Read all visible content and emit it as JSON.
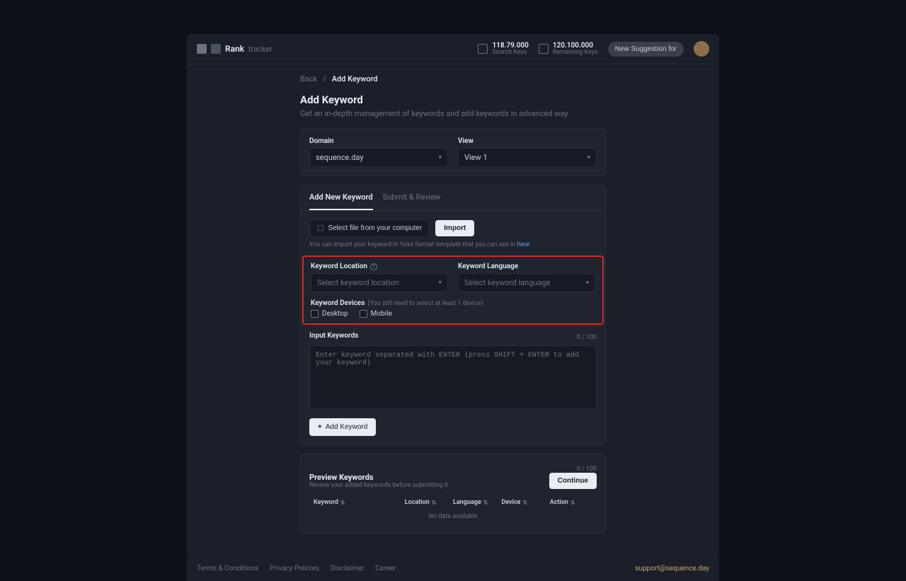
{
  "header": {
    "brand": "Rank",
    "brand_sub": "tracker",
    "stat1_num": "118.79.000",
    "stat1_label": "Search Keys",
    "stat2_num": "120.100.000",
    "stat2_label": "Remaining Keys",
    "cta": "New Suggestion for",
    "avatar": "user"
  },
  "breadcrumb": {
    "back": "Back",
    "current": "Add Keyword"
  },
  "page": {
    "title": "Add Keyword",
    "subtitle": "Get an in-depth management of keywords and add keywords in advanced way"
  },
  "domain_view": {
    "domain_label": "Domain",
    "domain_value": "sequence.day",
    "view_label": "View",
    "view_value": "View 1"
  },
  "tabs": {
    "add": "Add New Keyword",
    "submit": "Submit & Review"
  },
  "file": {
    "select": "Select file from your computer",
    "import": "Import",
    "hint_pre": "You can import your keyword in *xlsx format template that you can see in ",
    "hint_link": "here"
  },
  "location": {
    "label": "Keyword Location",
    "placeholder": "Select keyword location"
  },
  "language": {
    "label": "Keyword Language",
    "placeholder": "Select keyword language"
  },
  "devices": {
    "label": "Keyword Devices",
    "hint": "(You still need to select at least 1 device)",
    "desktop": "Desktop",
    "mobile": "Mobile"
  },
  "input_kw": {
    "label": "Input Keywords",
    "count": "0 / 100",
    "placeholder": "Enter keyword separated with ENTER (press SHIFT + ENTER to add your keyword)"
  },
  "add_btn": "Add Keyword",
  "preview": {
    "count": "0 / 100",
    "title": "Preview Keywords",
    "sub": "Review your added keywords before submitting it",
    "continue": "Continue",
    "cols": {
      "kw": "Keyword",
      "loc": "Location",
      "lang": "Language",
      "dev": "Device",
      "act": "Action"
    },
    "no_data": "No data available"
  },
  "footer": {
    "terms": "Terms & Conditions",
    "privacy": "Privacy Policies",
    "disclaimer": "Disclaimer",
    "career": "Career",
    "email": "support@sequence.day"
  }
}
